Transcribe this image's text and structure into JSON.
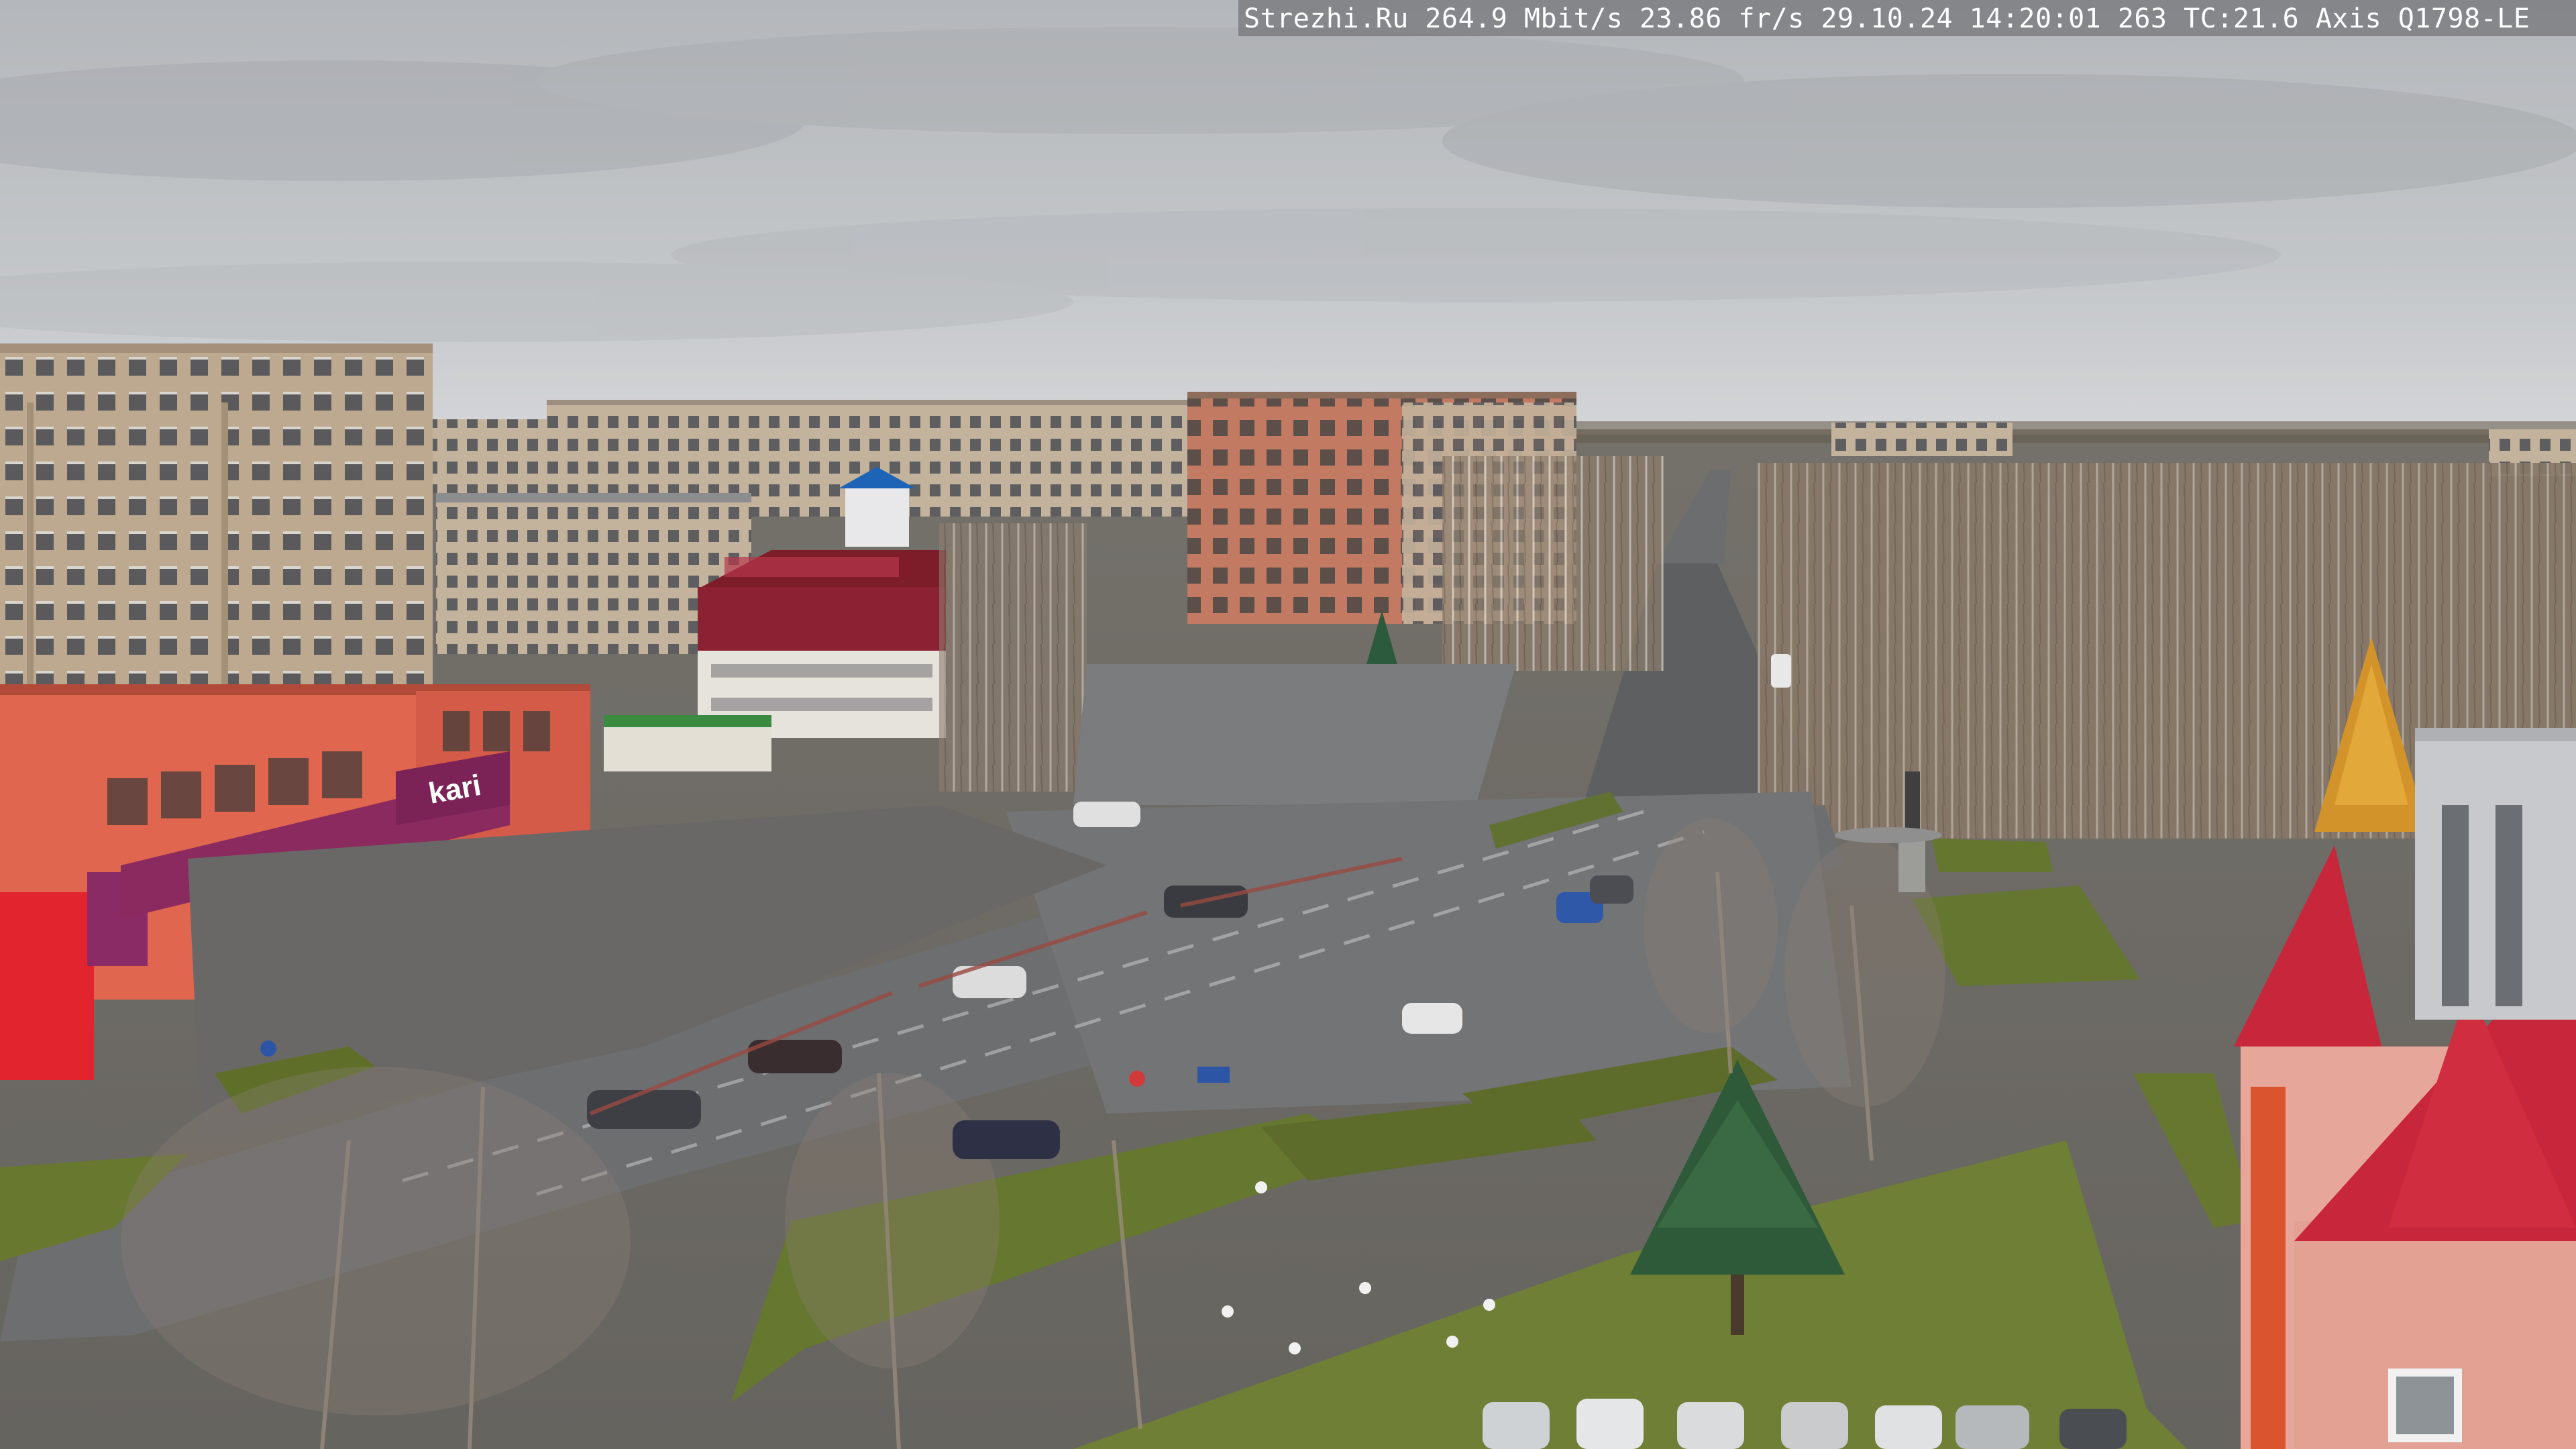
{
  "overlay": {
    "text": "Strezhi.Ru 264.9 Mbit/s 23.86 fr/s 29.10.24 14:20:01 263 TC:21.6  Axis Q1798-LE"
  },
  "signage": {
    "store_name": "kari"
  },
  "palette": {
    "sky_top": "#b7babe",
    "sky_bottom": "#d3d5d7",
    "asphalt": "#6f7173",
    "grass": "#6e7b3a",
    "panel_building": "#b9a48e",
    "store_red": "#e0664f",
    "kari_banner": "#8a2a5f",
    "roof_red": "#c8263a"
  },
  "icons": {
    "camera_overlay": "camera-osd-text"
  }
}
